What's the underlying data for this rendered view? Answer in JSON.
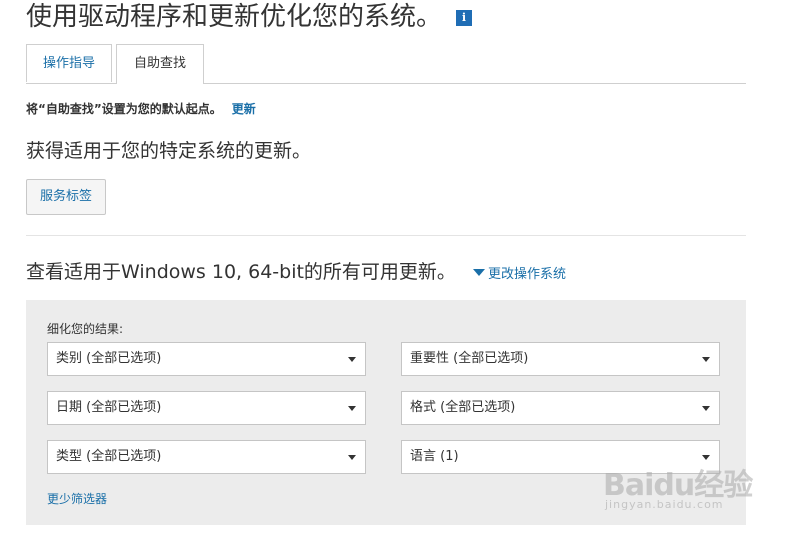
{
  "header": {
    "title": "使用驱动程序和更新优化您的系统。",
    "info_icon_glyph": "i"
  },
  "tabs": [
    {
      "label": "操作指导",
      "active": false
    },
    {
      "label": "自助查找",
      "active": true
    }
  ],
  "default_notice": {
    "text": "将“自助查找”设置为您的默认起点。",
    "link": "更新"
  },
  "specific_updates": {
    "heading": "获得适用于您的特定系统的更新。",
    "service_tag_button": "服务标签"
  },
  "all_updates": {
    "heading": "查看适用于Windows 10, 64-bit的所有可用更新。",
    "change_os_link": "更改操作系统"
  },
  "filters": {
    "refine_label": "细化您的结果:",
    "selects": [
      {
        "value": "类别 (全部已选项)"
      },
      {
        "value": "重要性 (全部已选项)"
      },
      {
        "value": "日期 (全部已选项)"
      },
      {
        "value": "格式 (全部已选项)"
      },
      {
        "value": "类型 (全部已选项)"
      },
      {
        "value": "语言 (1)"
      }
    ],
    "fewer_filters_link": "更少筛选器"
  },
  "watermark": {
    "logo_text": "Baidu经验",
    "url_text": "jingyan.baidu.com"
  },
  "colors": {
    "link": "#1a6fa8",
    "info_icon_bg": "#1f6db5",
    "panel_bg": "#ececec"
  }
}
